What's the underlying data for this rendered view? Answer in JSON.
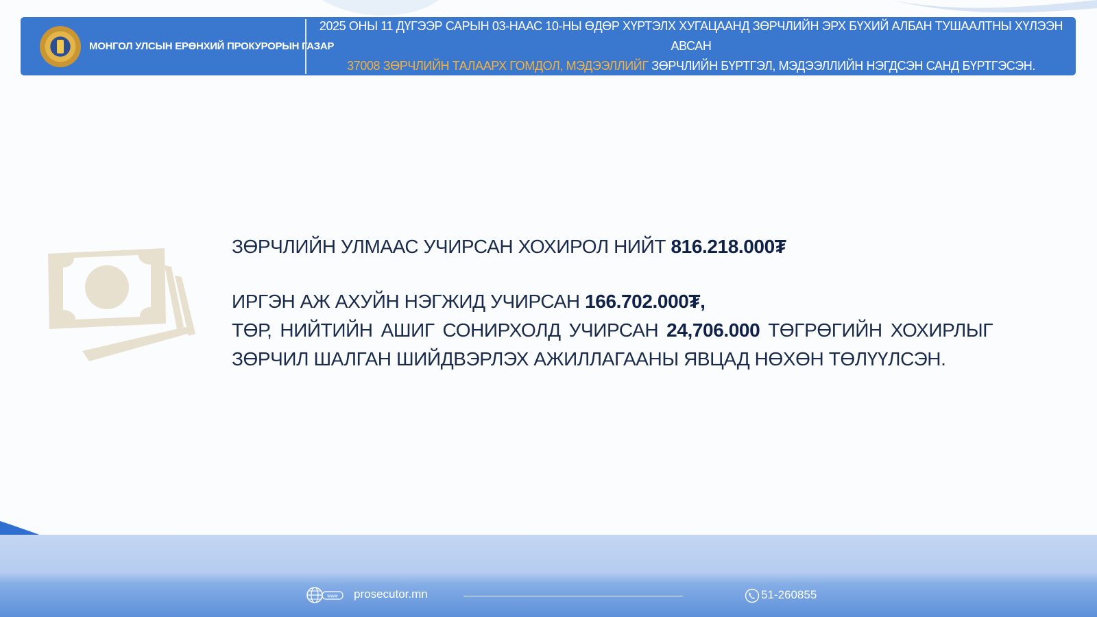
{
  "header": {
    "org_name": "МОНГОЛ УЛСЫН ЕРӨНХИЙ ПРОКУРОРЫН ГАЗАР",
    "headline_line1": "2025 ОНЫ 11 ДҮГЭЭР САРЫН 03-НААС 10-НЫ ӨДӨР ХҮРТЭЛХ ХУГАЦААНД ЗӨРЧЛИЙН ЭРХ БҮХИЙ АЛБАН ТУШААЛТНЫ ХҮЛЭЭН АВСАН",
    "headline_accent": "37008 ЗӨРЧЛИЙН ТАЛААРХ ГОМДОЛ, МЭДЭЭЛЛИЙГ",
    "headline_line2_rest": " ЗӨРЧЛИЙН БҮРТГЭЛ, МЭДЭЭЛЛИЙН НЭГДСЭН  САНД БҮРТГЭСЭН."
  },
  "content": {
    "total_label": "ЗӨРЧЛИЙН УЛМААС УЧИРСАН ХОХИРОЛ НИЙТ ",
    "total_value": "816.218.000₮",
    "citizen_label": "ИРГЭН АЖ АХУЙН НЭГЖИД УЧИРСАН ",
    "citizen_value": "166.702.000₮,",
    "public_label": "ТӨР, НИЙТИЙН АШИГ СОНИРХОЛД УЧИРСАН ",
    "public_value": "24,706.000",
    "public_rest": " ТӨГРӨГИЙН ХОХИРЛЫГ ЗӨРЧИЛ ШАЛГАН ШИЙДВЭРЛЭХ АЖИЛЛАГААНЫ ЯВЦАД НӨХӨН ТӨЛҮҮЛСЭН."
  },
  "footer": {
    "web_icon_text": "www",
    "website": "prosecutor.mn",
    "phone": "51-260855"
  },
  "icons": {
    "emblem": "state-emblem-icon",
    "money": "money-icon",
    "globe": "globe-icon",
    "phone": "phone-icon"
  },
  "colors": {
    "header_bg": "#3a78cf",
    "accent": "#f4b13e",
    "text": "#1a2a4a",
    "money_icon": "#e8e0cf"
  }
}
